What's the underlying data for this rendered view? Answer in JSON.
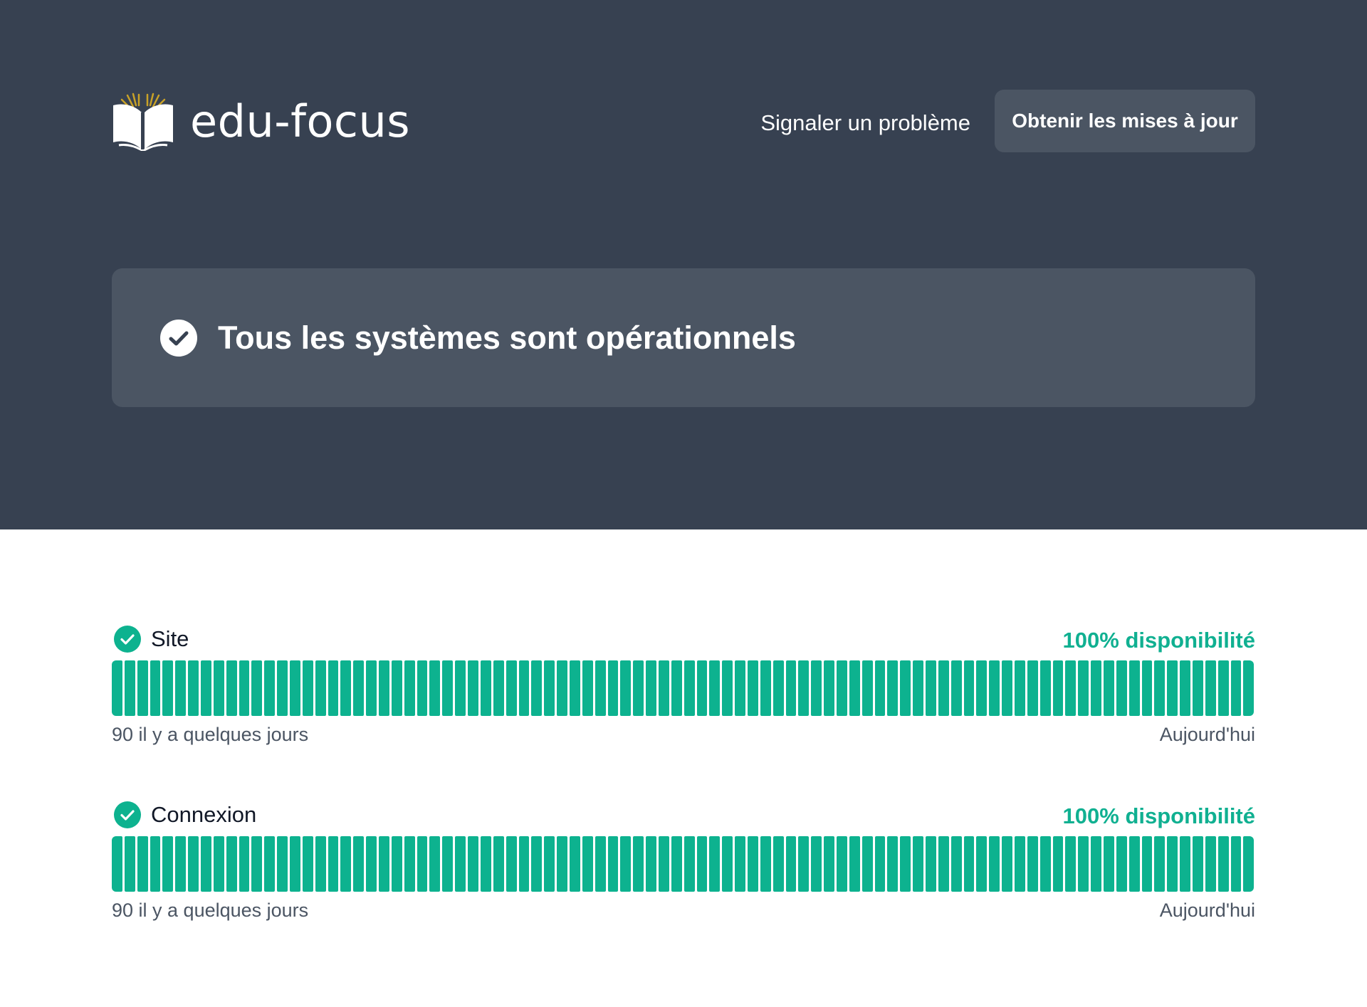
{
  "colors": {
    "hero_background": "#374151",
    "panel_background": "#4b5563",
    "operational_green": "#0db28f",
    "text_muted": "#4b5563"
  },
  "header": {
    "brand_name": "edu-focus",
    "logo_icon": "open-book-icon",
    "report_link": "Signaler un problème",
    "subscribe_button": "Obtenir les mises à jour"
  },
  "status_banner": {
    "icon": "check-circle-icon",
    "text": "Tous les systèmes sont opérationnels"
  },
  "components": [
    {
      "name": "Site",
      "status_icon": "check-circle-icon",
      "uptime_label": "100% disponibilité",
      "uptime_percent": 100,
      "days": 90,
      "range_start_label": "90 il y a quelques jours",
      "range_end_label": "Aujourd'hui"
    },
    {
      "name": "Connexion",
      "status_icon": "check-circle-icon",
      "uptime_label": "100% disponibilité",
      "uptime_percent": 100,
      "days": 90,
      "range_start_label": "90 il y a quelques jours",
      "range_end_label": "Aujourd'hui"
    }
  ]
}
